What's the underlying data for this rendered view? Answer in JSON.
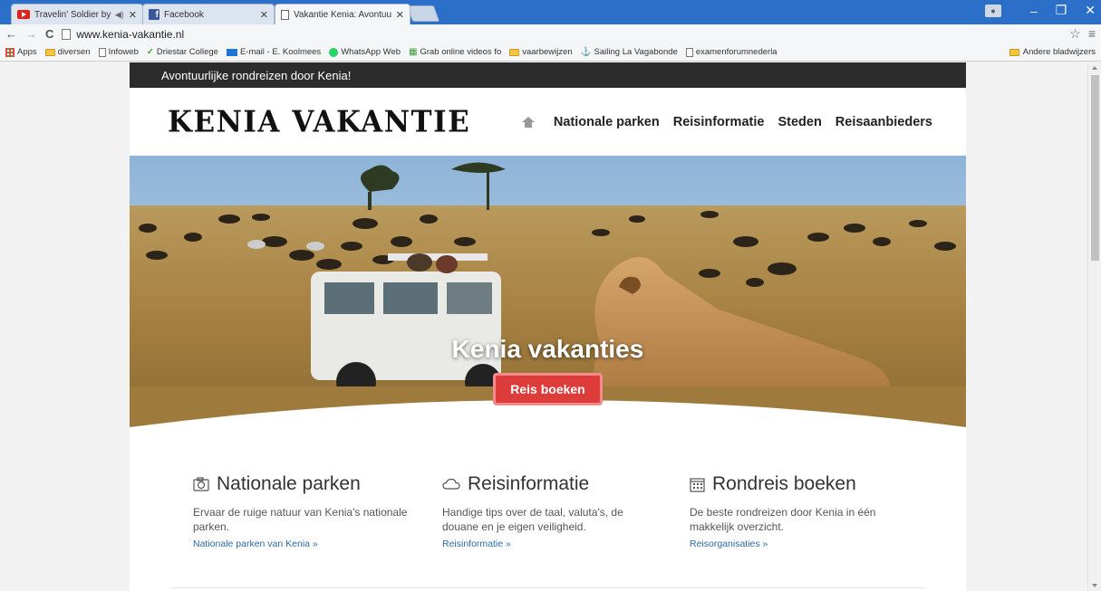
{
  "browser": {
    "tabs": [
      {
        "title": "Travelin' Soldier by the",
        "icon": "youtube-icon",
        "audio": "◀)"
      },
      {
        "title": "Facebook",
        "icon": "facebook-icon"
      },
      {
        "title": "Vakantie Kenia: Avontuurl",
        "icon": "document-icon",
        "active": true
      }
    ],
    "close_glyph": "✕",
    "url": "www.kenia-vakantie.nl",
    "bookmarks": [
      {
        "label": "Apps",
        "icon": "apps-icon"
      },
      {
        "label": "diversen",
        "icon": "folder-icon"
      },
      {
        "label": "Infoweb",
        "icon": "document-icon"
      },
      {
        "label": "Driestar College",
        "icon": "driestar-icon"
      },
      {
        "label": "E-mail - E. Koolmees",
        "icon": "mail-icon"
      },
      {
        "label": "WhatsApp Web",
        "icon": "whatsapp-icon"
      },
      {
        "label": "Grab online videos fo",
        "icon": "video-icon"
      },
      {
        "label": "vaarbewijzen",
        "icon": "folder-icon"
      },
      {
        "label": "Sailing La Vagabonde",
        "icon": "anchor-icon"
      },
      {
        "label": "examenforumnederla",
        "icon": "document-icon"
      }
    ],
    "other_bookmarks": "Andere bladwijzers"
  },
  "site": {
    "topstrip": "Avontuurlijke rondreizen door Kenia!",
    "logo": "KENIA VAKANTIE",
    "nav": [
      "Nationale parken",
      "Reisinformatie",
      "Steden",
      "Reisaanbieders"
    ],
    "hero": {
      "title": "Kenia vakanties",
      "button": "Reis boeken"
    },
    "features": [
      {
        "icon": "camera-icon",
        "title": "Nationale parken",
        "desc": "Ervaar de ruige natuur van Kenia's nationale parken.",
        "link": "Nationale parken van Kenia »"
      },
      {
        "icon": "cloud-icon",
        "title": "Reisinformatie",
        "desc": "Handige tips over de taal, valuta's, de douane en je eigen veiligheid.",
        "link": "Reisinformatie »"
      },
      {
        "icon": "calendar-icon",
        "title": "Rondreis boeken",
        "desc": "De beste rondreizen door Kenia in één makkelijk overzicht.",
        "link": "Reisorganisaties »"
      }
    ]
  },
  "colors": {
    "tabbar": "#2b6fc9",
    "topstrip": "#2c2c2c",
    "button": "#de3b3b",
    "link": "#2a6aa8"
  }
}
